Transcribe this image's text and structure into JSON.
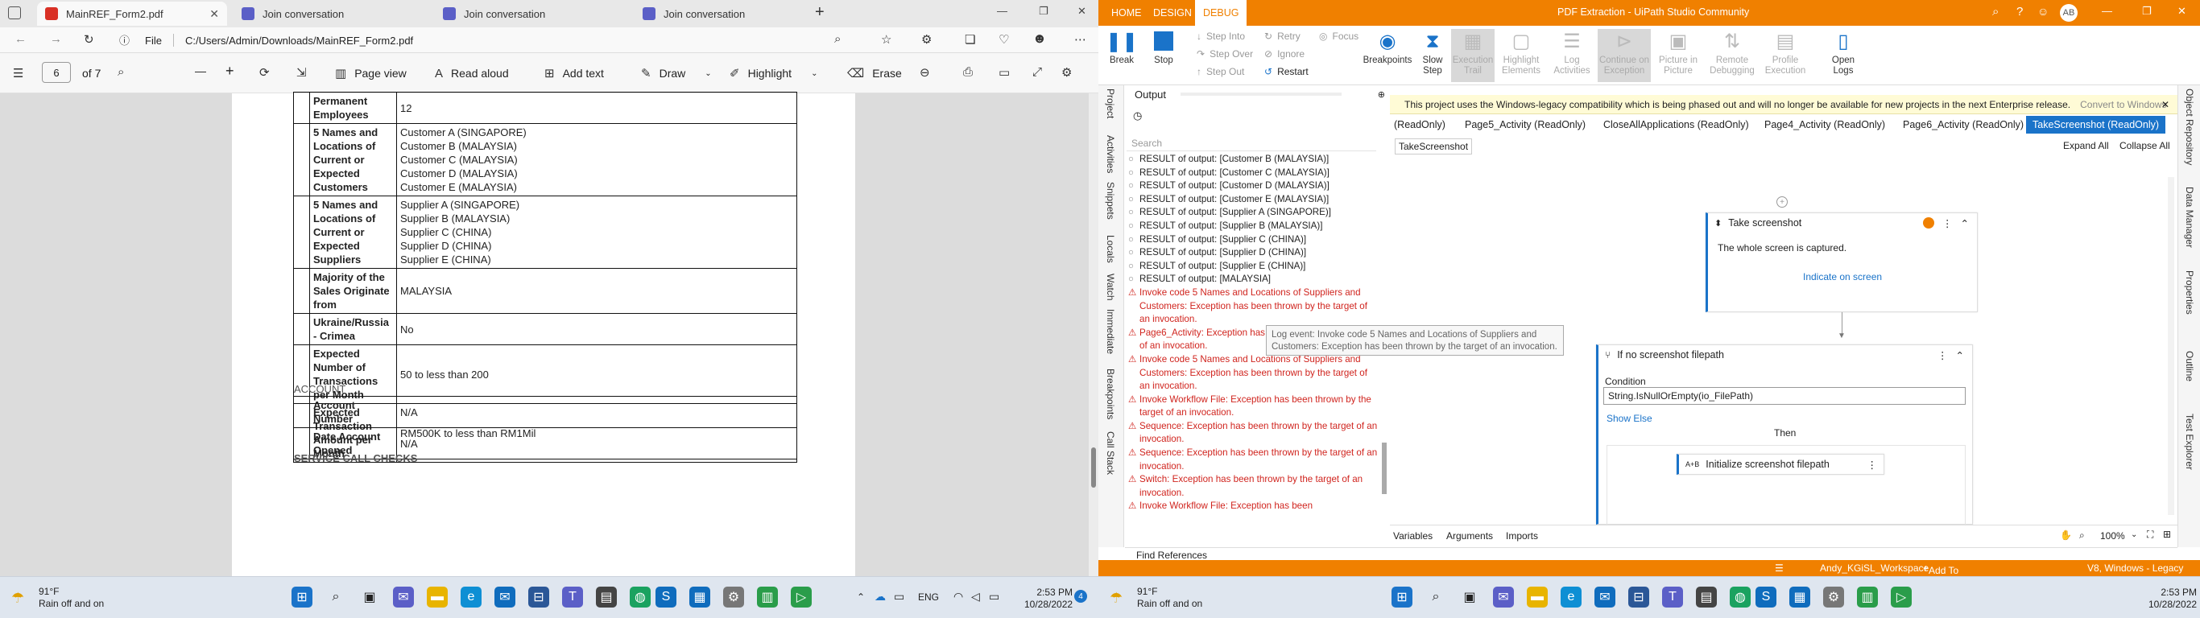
{
  "edge": {
    "tabs": [
      {
        "title": "MainREF_Form2.pdf",
        "color": "#d93025",
        "active": true
      },
      {
        "title": "Join conversation",
        "color": "#5b5fc7",
        "active": false
      },
      {
        "title": "Join conversation",
        "color": "#5b5fc7",
        "active": false
      },
      {
        "title": "Join conversation",
        "color": "#5b5fc7",
        "active": false
      }
    ],
    "new_tab": "+",
    "window_controls": [
      "—",
      "❐",
      "✕"
    ],
    "address": {
      "prefix": "File",
      "url": "C:/Users/Admin/Downloads/MainREF_Form2.pdf"
    },
    "pdf_toolbar": {
      "page_current": "6",
      "page_total": "of 7",
      "zoom_out": "—",
      "zoom_in": "+",
      "page_view": "Page view",
      "read_aloud": "Read aloud",
      "add_text": "Add text",
      "draw": "Draw",
      "highlight": "Highlight",
      "erase": "Erase"
    },
    "doc": {
      "rows": [
        {
          "label": "Permanent Employees",
          "value": [
            "12"
          ]
        },
        {
          "label": "5 Names and Locations of Current or Expected Customers",
          "value": [
            "Customer A (SINGAPORE)",
            "Customer B (MALAYSIA)",
            "Customer C (MALAYSIA)",
            "Customer D (MALAYSIA)",
            "Customer E (MALAYSIA)"
          ]
        },
        {
          "label": "5 Names and Locations of Current or Expected Suppliers",
          "value": [
            "Supplier A (SINGAPORE)",
            "Supplier B (MALAYSIA)",
            "Supplier C (CHINA)",
            "Supplier D (CHINA)",
            "Supplier E (CHINA)"
          ]
        },
        {
          "label": "Majority of the Sales Originate from",
          "value": [
            "MALAYSIA"
          ]
        },
        {
          "label": "Ukraine/Russia - Crimea",
          "value": [
            "No"
          ]
        },
        {
          "label": "Expected Number of Transactions per Month",
          "value": [
            "50 to less than 200"
          ]
        },
        {
          "label": "Expected Transaction Amount per Month",
          "value": [
            "RM500K to less than RM1Mil"
          ]
        }
      ],
      "account_heading": "ACCOUNT",
      "account_rows": [
        {
          "label": "Account Number",
          "value": "N/A"
        },
        {
          "label": "Date Account Opened",
          "value": "N/A"
        }
      ],
      "service_heading": "SERVICE CALL CHECKS"
    }
  },
  "studio": {
    "ribbon_tabs": [
      "HOME",
      "DESIGN",
      "DEBUG"
    ],
    "title": "PDF Extraction - UiPath Studio Community",
    "user_initials": "AB",
    "ribbon": {
      "break": "Break",
      "stop": "Stop",
      "step_into": "Step Into",
      "step_over": "Step Over",
      "step_out": "Step Out",
      "retry": "Retry",
      "ignore": "Ignore",
      "restart": "Restart",
      "focus": "Focus",
      "breakpoints": "Breakpoints",
      "slow_step": "Slow\nStep",
      "execution_trail": "Execution\nTrail",
      "highlight_elements": "Highlight\nElements",
      "log_activities": "Log\nActivities",
      "continue_on_exception": "Continue on\nException",
      "picture_in_picture": "Picture in\nPicture",
      "remote_debugging": "Remote\nDebugging",
      "profile_execution": "Profile\nExecution",
      "open_logs": "Open\nLogs"
    },
    "left_panels": [
      "Project",
      "Activities",
      "Snippets",
      "Locals",
      "Watch",
      "Immediate",
      "Breakpoints",
      "Call Stack"
    ],
    "right_panels": [
      "Object Repository",
      "Data Manager",
      "Properties",
      "Outline",
      "Test Explorer"
    ],
    "output": {
      "title": "Output",
      "search_placeholder": "Search",
      "lines": [
        {
          "t": "RESULT of output: [Customer B (MALAYSIA)]",
          "err": false
        },
        {
          "t": "RESULT of output: [Customer C (MALAYSIA)]",
          "err": false
        },
        {
          "t": "RESULT of output: [Customer D (MALAYSIA)]",
          "err": false
        },
        {
          "t": "RESULT of output: [Customer E (MALAYSIA)]",
          "err": false
        },
        {
          "t": "RESULT of output: [Supplier A (SINGAPORE)]",
          "err": false
        },
        {
          "t": "RESULT of output: [Supplier B (MALAYSIA)]",
          "err": false
        },
        {
          "t": "RESULT of output: [Supplier C (CHINA)]",
          "err": false
        },
        {
          "t": "RESULT of output: [Supplier D (CHINA)]",
          "err": false
        },
        {
          "t": "RESULT of output: [Supplier E (CHINA)]",
          "err": false
        },
        {
          "t": "RESULT of output: [MALAYSIA]",
          "err": false
        },
        {
          "t": "Invoke code 5 Names and Locations of Suppliers and Customers: Exception has been thrown by the target of an invocation.",
          "err": true
        },
        {
          "t": "Page6_Activity: Exception has been thrown by the target of an invocation.",
          "err": true
        },
        {
          "t": "Invoke code 5 Names and Locations of Suppliers and Customers: Exception has been thrown by the target of an invocation.",
          "err": true
        },
        {
          "t": "Invoke Workflow File: Exception has been thrown by the target of an invocation.",
          "err": true
        },
        {
          "t": "Sequence: Exception has been thrown by the target of an invocation.",
          "err": true
        },
        {
          "t": "Sequence: Exception has been thrown by the target of an invocation.",
          "err": true
        },
        {
          "t": "Switch: Exception has been thrown by the target of an invocation.",
          "err": true
        },
        {
          "t": "Invoke Workflow File: Exception has been",
          "err": true
        }
      ],
      "tooltip": "Log event: Invoke code 5 Names and Locations of Suppliers and Customers: Exception has been thrown by the target of an invocation."
    },
    "warning": {
      "text": "This project uses the Windows-legacy compatibility which is being phased out and will no longer be available for new projects in the next Enterprise release.",
      "link": "Convert to Windows"
    },
    "doc_tabs": [
      "(ReadOnly)",
      "Page5_Activity (ReadOnly)",
      "CloseAllApplications (ReadOnly)",
      "Page4_Activity (ReadOnly)",
      "Page6_Activity (ReadOnly)",
      "TakeScreenshot (ReadOnly)"
    ],
    "breadcrumb": "TakeScreenshot",
    "expand_all": "Expand All",
    "collapse_all": "Collapse All",
    "take_screenshot": {
      "title": "Take screenshot",
      "desc": "The whole screen is captured.",
      "link": "Indicate on screen"
    },
    "if_activity": {
      "title": "If no screenshot filepath",
      "condition_label": "Condition",
      "condition_value": "String.IsNullOrEmpty(io_FilePath)",
      "show_else": "Show Else",
      "then": "Then",
      "inner_title": "Initialize screenshot filepath",
      "inner_badge": "A+B"
    },
    "footer": {
      "variables": "Variables",
      "arguments": "Arguments",
      "imports": "Imports",
      "zoom": "100%"
    },
    "find_references": "Find References",
    "statusbar": {
      "workspace": "Andy_KGiSL_Workspace",
      "source_control": "Add To Source Control",
      "version": "V8, Windows - Legacy"
    }
  },
  "taskbar": {
    "weather_temp": "91°F",
    "weather_desc": "Rain off and on",
    "lang": "ENG",
    "time": "2:53 PM",
    "date": "10/28/2022",
    "notif_count": "4"
  }
}
